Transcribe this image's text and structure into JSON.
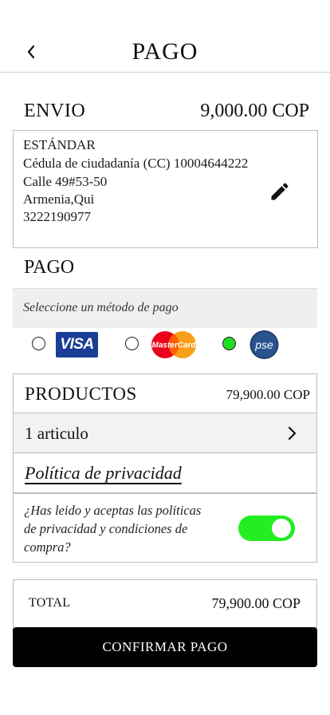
{
  "header": {
    "title": "PAGO"
  },
  "envio": {
    "label": "ENVIO",
    "price": "9,000.00 COP"
  },
  "address": {
    "type": "ESTÁNDAR",
    "id_doc": "Cédula de ciudadanía (CC) 10004644222",
    "street": "Calle 49#53-50",
    "city": "Armenia,Qui",
    "phone": "3222190977"
  },
  "pago": {
    "label": "PAGO",
    "method_prompt": "Seleccione un método de pago",
    "methods": [
      {
        "name": "VISA",
        "selected": false
      },
      {
        "name": "MasterCard",
        "selected": false
      },
      {
        "name": "pse",
        "selected": true
      }
    ]
  },
  "productos": {
    "label": "PRODUCTOS",
    "price": "79,900.00 COP",
    "items_label": "1 articulo"
  },
  "policy": {
    "link": "Política de privacidad",
    "accept_text": "¿Has leido y aceptas las politicas de privacidad y condiciones de compra?",
    "accepted": true
  },
  "total": {
    "label": "TOTAL",
    "price": "79,900.00 COP"
  },
  "confirm": {
    "label": "CONFIRMAR PAGO"
  },
  "colors": {
    "accent_green": "#22ee22",
    "visa_blue": "#1a3d96",
    "button_black": "#000000"
  }
}
